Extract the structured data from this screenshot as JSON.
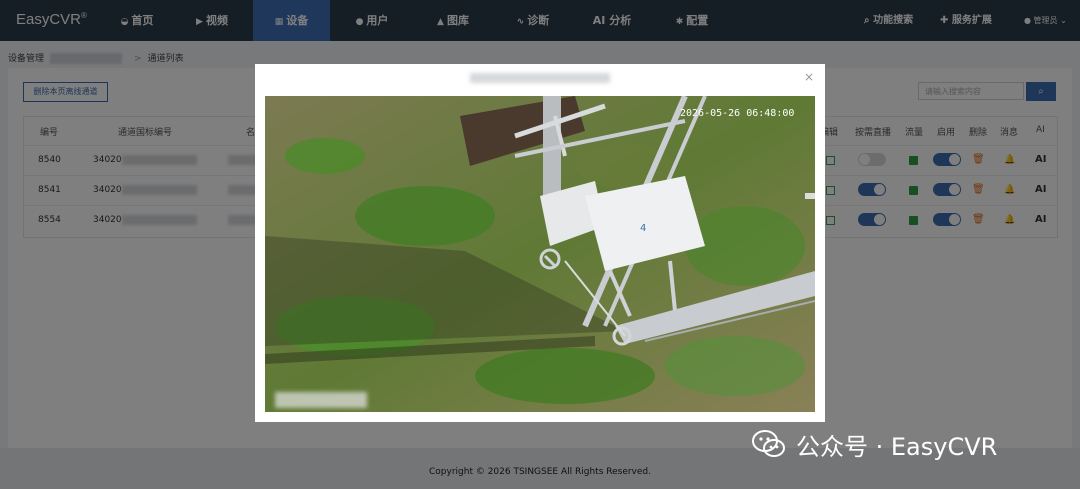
{
  "header": {
    "brand": "EasyCVR",
    "brand_mark": "®",
    "nav": [
      {
        "label": "首页",
        "icon": "dashboard-icon"
      },
      {
        "label": "视频",
        "icon": "play-icon"
      },
      {
        "label": "设备",
        "icon": "device-icon",
        "active": true
      },
      {
        "label": "用户",
        "icon": "user-icon"
      },
      {
        "label": "图库",
        "icon": "gallery-icon"
      },
      {
        "label": "诊断",
        "icon": "pulse-icon"
      },
      {
        "label": "AI 分析",
        "icon": ""
      },
      {
        "label": "配置",
        "icon": "gear-icon"
      }
    ],
    "feature_search": "功能搜索",
    "service_ext": "服务扩展",
    "user": "管理员"
  },
  "breadcrumb": {
    "root": "设备管理",
    "current": "通道列表"
  },
  "toolbar": {
    "delete_offline": "删除本页离线通道",
    "search_placeholder": "请输入搜索内容"
  },
  "table": {
    "headers": {
      "id": "编号",
      "channel_code": "通道国标编号",
      "name": "名",
      "edit": "编辑",
      "on_demand": "按需直播",
      "flow": "流量",
      "enable": "启用",
      "delete": "删除",
      "message": "消息",
      "ai": "AI"
    },
    "rows": [
      {
        "id": "8540",
        "code_prefix": "34020",
        "on_demand": false,
        "enabled": true,
        "ai": "AI"
      },
      {
        "id": "8541",
        "code_prefix": "34020",
        "on_demand": true,
        "enabled": true,
        "ai": "AI"
      },
      {
        "id": "8554",
        "code_prefix": "34020",
        "on_demand": true,
        "enabled": true,
        "ai": "AI"
      }
    ]
  },
  "modal": {
    "timestamp": "2026-05-26 06:48:00",
    "close": "×"
  },
  "footer": {
    "copyright": "Copyright © 2026 TSINGSEE All Rights Reserved."
  },
  "watermark": {
    "text": "公众号 · EasyCVR"
  },
  "colors": {
    "topbar": "#2b3a4a",
    "accent": "#3f6fb6",
    "toggle_on": "#3d6fb3",
    "toggle_off": "#d9d9d9"
  }
}
